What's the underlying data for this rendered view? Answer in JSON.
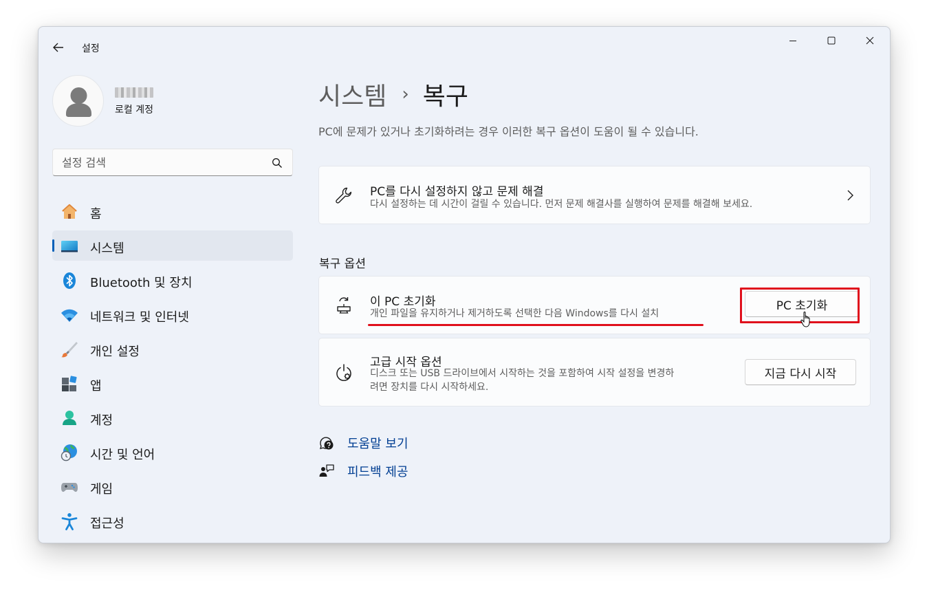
{
  "window": {
    "title": "설정",
    "controls": {
      "minimize": "minimize-icon",
      "maximize": "maximize-icon",
      "close": "close-icon"
    }
  },
  "user": {
    "account_type": "로컬 계정"
  },
  "search": {
    "placeholder": "설정 검색",
    "value": ""
  },
  "sidebar": {
    "items": [
      {
        "label": "홈",
        "icon": "home-icon",
        "selected": false
      },
      {
        "label": "시스템",
        "icon": "system-display-icon",
        "selected": true
      },
      {
        "label": "Bluetooth 및 장치",
        "icon": "bluetooth-icon",
        "selected": false
      },
      {
        "label": "네트워크 및 인터넷",
        "icon": "wifi-icon",
        "selected": false
      },
      {
        "label": "개인 설정",
        "icon": "paintbrush-icon",
        "selected": false
      },
      {
        "label": "앱",
        "icon": "apps-icon",
        "selected": false
      },
      {
        "label": "계정",
        "icon": "account-icon",
        "selected": false
      },
      {
        "label": "시간 및 언어",
        "icon": "globe-clock-icon",
        "selected": false
      },
      {
        "label": "게임",
        "icon": "gamepad-icon",
        "selected": false
      },
      {
        "label": "접근성",
        "icon": "accessibility-icon",
        "selected": false
      }
    ]
  },
  "main": {
    "breadcrumb": {
      "parent": "시스템",
      "separator": "›",
      "current": "복구"
    },
    "description": "PC에 문제가 있거나 초기화하려는 경우 이러한 복구 옵션이 도움이 될 수 있습니다.",
    "troubleshoot_card": {
      "title": "PC를 다시 설정하지 않고 문제 해결",
      "subtitle": "다시 설정하는 데 시간이 걸릴 수 있습니다. 먼저 문제 해결사를 실행하여 문제를 해결해 보세요."
    },
    "recovery_options_title": "복구 옵션",
    "reset_card": {
      "title": "이 PC 초기화",
      "subtitle": "개인 파일을 유지하거나 제거하도록 선택한 다음 Windows를 다시 설치",
      "button": "PC 초기화"
    },
    "advanced_card": {
      "title": "고급 시작 옵션",
      "subtitle_line1": "디스크 또는 USB 드라이브에서 시작하는 것을 포함하여 시작 설정을 변경하",
      "subtitle_line2": "려면 장치를 다시 시작하세요.",
      "button": "지금 다시 시작"
    },
    "links": {
      "help": "도움말 보기",
      "feedback": "피드백 제공"
    }
  },
  "colors": {
    "accent": "#005fb8",
    "annotation_red": "#e0101c",
    "link": "#003e92",
    "window_bg": "#eef2f9"
  }
}
